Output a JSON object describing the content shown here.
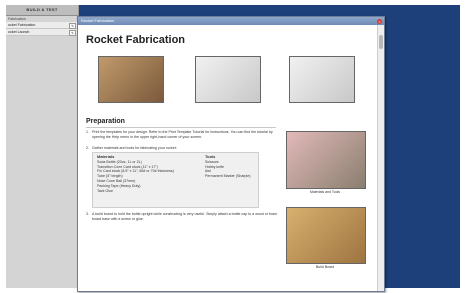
{
  "sidebar": {
    "header": "BUILD & TEST",
    "section": "Fabrication",
    "items": [
      {
        "label": "ocket Fabrication",
        "btn": "✎"
      },
      {
        "label": "ocket Launch",
        "btn": "✎"
      }
    ]
  },
  "window": {
    "title": "Rocket Fabrication",
    "close": "×"
  },
  "page": {
    "title": "Rocket Fabrication",
    "section_title": "Preparation",
    "steps": [
      {
        "num": "1.",
        "text": "Print the templates for your design. Refer to the Print Template Tutorial for instructions. You can find the tutorial by opening the Help menu in the upper right-hand corner of your screen."
      },
      {
        "num": "2.",
        "text": "Gather materials and tools for fabricating your rocket:"
      },
      {
        "num": "3.",
        "text": "A build board to hold the bottle upright while constructing is very useful. Simply attach a bottle cap to a wood or foam board base with a screw or glue."
      }
    ],
    "materials_title": "Materials",
    "materials": [
      "Soda Bottle (20oz, 1L or 2L)",
      "Transition Cone Card stock (11\" x 17\")",
      "Fin Card stock (8.5\" x 11\", 65# or 70# thickness)",
      "Tube (5\" length)",
      "Nose Cone Ball (37mm)",
      "Packing Tape (Heavy Duty)",
      "Tack Glue"
    ],
    "tools_title": "Tools",
    "tools": [
      "Scissors",
      "Hobby knife",
      "Awl",
      "Permanent Marker (Sharpie)"
    ],
    "caption_materials": "Materials and Tools",
    "caption_board": "Build Board"
  }
}
